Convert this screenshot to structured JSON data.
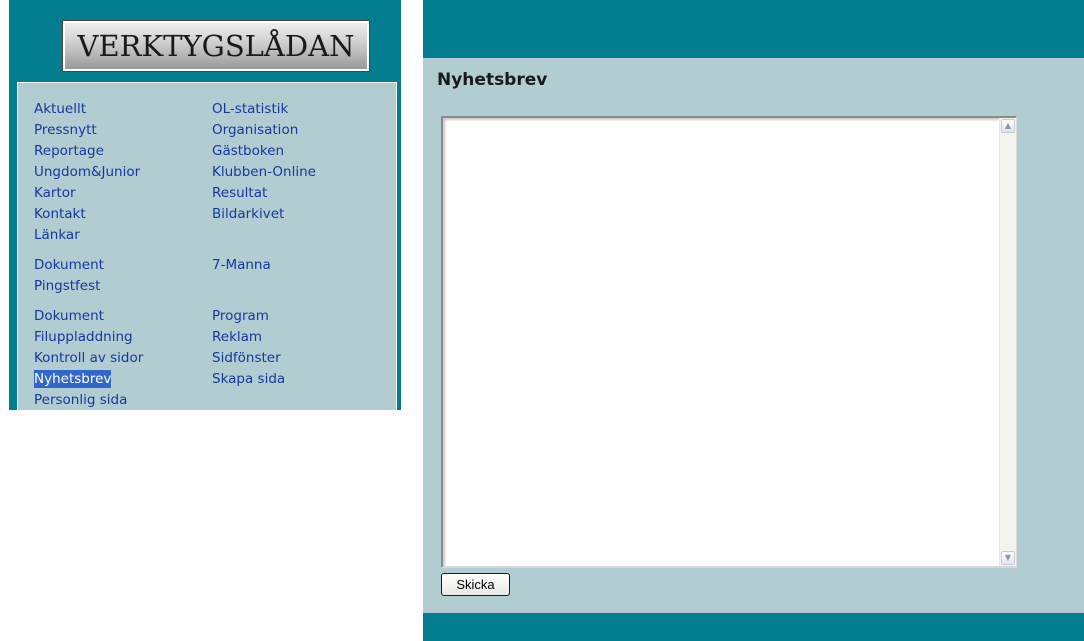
{
  "logo": {
    "text": "VERKTYGSLÅDAN"
  },
  "menu": {
    "left": [
      "Aktuellt",
      "Pressnytt",
      "Reportage",
      "Ungdom&Junior",
      "Kartor",
      "Kontakt",
      "Länkar",
      "Dokument",
      "Pingstfest",
      "Dokument",
      "Filuppladdning",
      "Kontroll av sidor",
      "Nyhetsbrev",
      "Personlig sida"
    ],
    "right": [
      "OL-statistik",
      "Organisation",
      "Gästboken",
      "Klubben-Online",
      "Resultat",
      "Bildarkivet",
      "7-Manna",
      "Program",
      "Reklam",
      "Sidfönster",
      "Skapa sida"
    ],
    "active": "Nyhetsbrev"
  },
  "content": {
    "title": "Nyhetsbrev",
    "textarea_value": "",
    "send_label": "Skicka"
  },
  "colors": {
    "frame": "#037e91",
    "panel": "#b1cdd2",
    "link": "#16389c",
    "active_highlight": "#3167c9"
  },
  "icons": {
    "scroll_up": "scroll-up-arrow-icon",
    "scroll_down": "scroll-down-arrow-icon"
  }
}
